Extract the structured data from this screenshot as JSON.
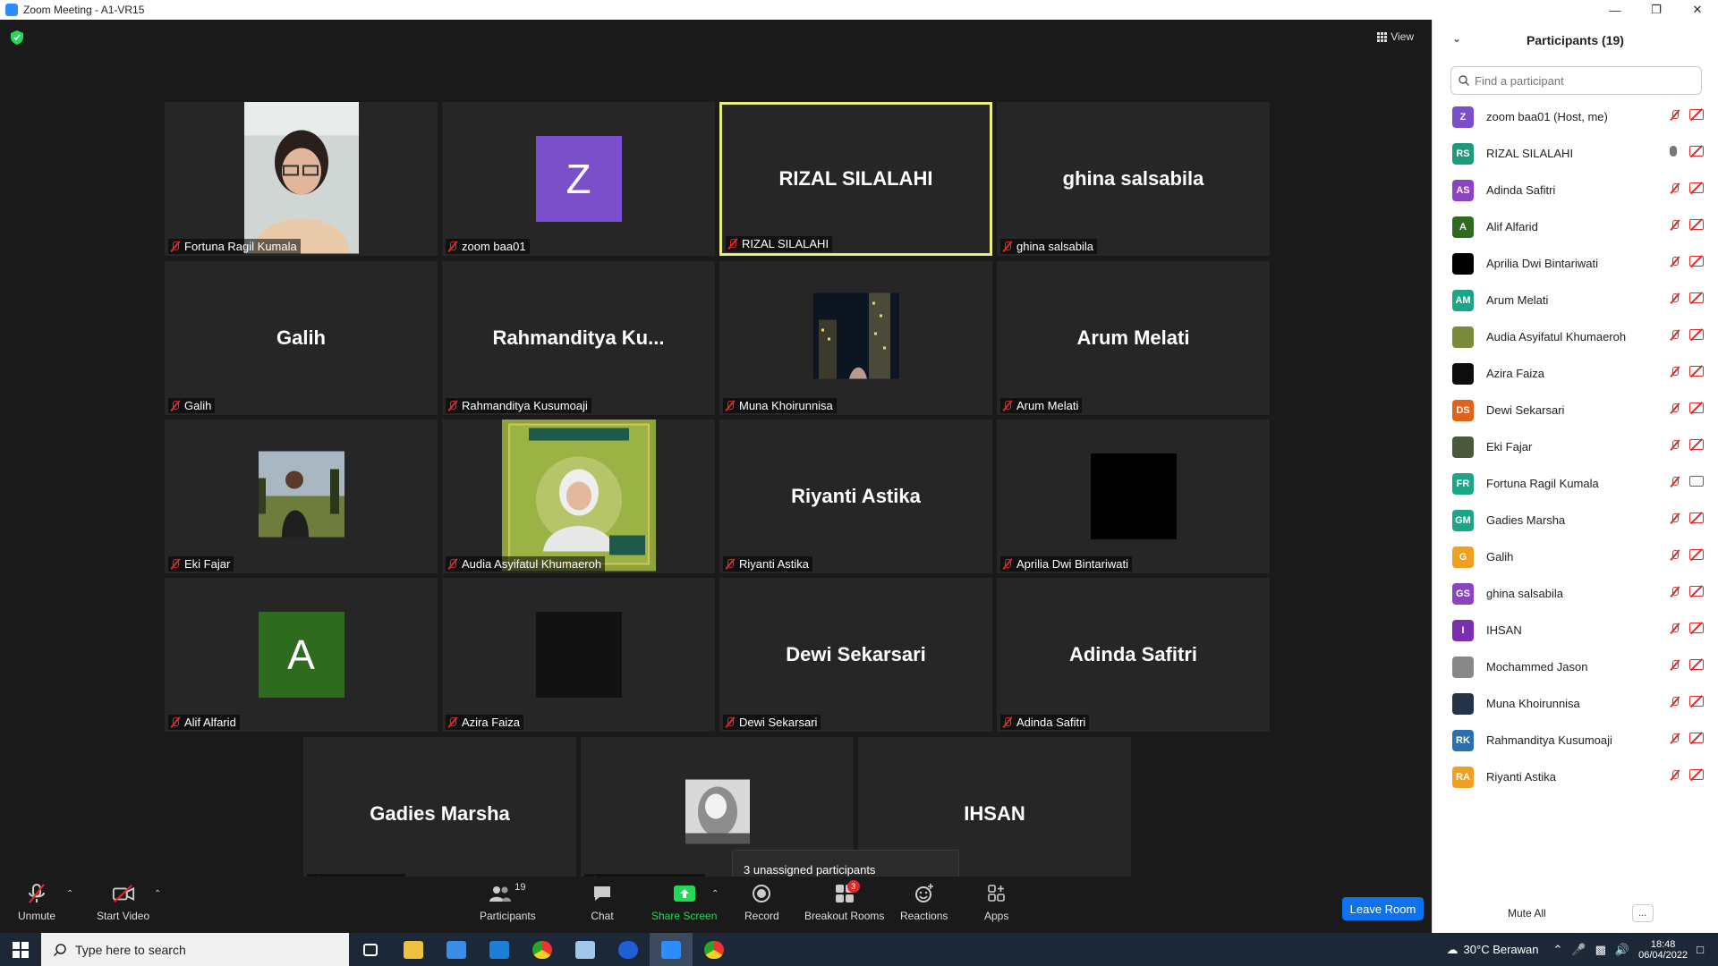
{
  "window": {
    "title": "Zoom Meeting - A1-VR15",
    "min": "—",
    "max": "❐",
    "close": "✕"
  },
  "stage": {
    "view_label": "View"
  },
  "tiles": [
    {
      "id": "t1",
      "caption": "Fortuna Ragil Kumala",
      "big": "",
      "type": "photo",
      "photo": "girl"
    },
    {
      "id": "t2",
      "caption": "zoom baa01",
      "big": "",
      "type": "letter",
      "letter": "Z",
      "color": "#7b4fc9"
    },
    {
      "id": "t3",
      "caption": "RIZAL SILALAHI",
      "big": "RIZAL SILALAHI",
      "type": "name",
      "active": true
    },
    {
      "id": "t4",
      "caption": "ghina salsabila",
      "big": "ghina salsabila",
      "type": "name"
    },
    {
      "id": "t5",
      "caption": "Galih",
      "big": "Galih",
      "type": "name"
    },
    {
      "id": "t6",
      "caption": "Rahmanditya Kusumoaji",
      "big": "Rahmanditya  Ku...",
      "type": "name"
    },
    {
      "id": "t7",
      "caption": "Muna Khoirunnisa",
      "big": "",
      "type": "photo",
      "photo": "city"
    },
    {
      "id": "t8",
      "caption": "Arum Melati",
      "big": "Arum Melati",
      "type": "name"
    },
    {
      "id": "t9",
      "caption": "Eki Fajar",
      "big": "",
      "type": "photo",
      "photo": "field"
    },
    {
      "id": "t10",
      "caption": "Audia Asyifatul Khumaeroh",
      "big": "",
      "type": "photo",
      "photo": "poster"
    },
    {
      "id": "t11",
      "caption": "Riyanti Astika",
      "big": "Riyanti Astika",
      "type": "name"
    },
    {
      "id": "t12",
      "caption": "Aprilia Dwi Bintariwati",
      "big": "",
      "type": "letter",
      "letter": "",
      "color": "#000000"
    },
    {
      "id": "t13",
      "caption": "Alif Alfarid",
      "big": "",
      "type": "letter",
      "letter": "A",
      "color": "#2e6b1f"
    },
    {
      "id": "t14",
      "caption": "Azira Faiza",
      "big": "",
      "type": "letter",
      "letter": "",
      "color": "#121212"
    },
    {
      "id": "t15",
      "caption": "Dewi Sekarsari",
      "big": "Dewi Sekarsari",
      "type": "name"
    },
    {
      "id": "t16",
      "caption": "Adinda Safitri",
      "big": "Adinda Safitri",
      "type": "name"
    },
    {
      "id": "t17",
      "caption": "Gadies Marsha",
      "big": "Gadies Marsha",
      "type": "name"
    },
    {
      "id": "t18",
      "caption": "Mochammed Jason",
      "big": "",
      "type": "photo",
      "photo": "statue"
    },
    {
      "id": "t19",
      "caption": "",
      "big": "IHSAN",
      "type": "name"
    }
  ],
  "popup": {
    "text": "3 unassigned participants"
  },
  "toolbar": {
    "unmute": "Unmute",
    "start_video": "Start Video",
    "participants": "Participants",
    "participants_count": "19",
    "chat": "Chat",
    "share_screen": "Share Screen",
    "record": "Record",
    "breakout_rooms": "Breakout Rooms",
    "breakout_badge": "3",
    "reactions": "Reactions",
    "apps": "Apps",
    "leave": "Leave Room"
  },
  "panel": {
    "title": "Participants (19)",
    "search_placeholder": "Find a participant",
    "mute_all": "Mute All",
    "more": "...",
    "participants": [
      {
        "initials": "Z",
        "name": "zoom baa01 (Host, me)",
        "color": "#7b4fc9",
        "mic": "off",
        "video": "off"
      },
      {
        "initials": "RS",
        "name": "RIZAL SILALAHI",
        "color": "#1c9a7a",
        "mic": "on",
        "video": "off"
      },
      {
        "initials": "AS",
        "name": "Adinda Safitri",
        "color": "#8a43c2",
        "mic": "off",
        "video": "off"
      },
      {
        "initials": "A",
        "name": "Alif Alfarid",
        "color": "#2e6b1f",
        "mic": "off",
        "video": "off"
      },
      {
        "initials": "",
        "name": "Aprilia Dwi Bintariwati",
        "color": "#000000",
        "mic": "off",
        "video": "off"
      },
      {
        "initials": "AM",
        "name": "Arum Melati",
        "color": "#1ca688",
        "mic": "off",
        "video": "off"
      },
      {
        "initials": "",
        "name": "Audia Asyifatul Khumaeroh",
        "color": "#7a8b3a",
        "mic": "off",
        "video": "off"
      },
      {
        "initials": "",
        "name": "Azira Faiza",
        "color": "#0d0d0d",
        "mic": "off",
        "video": "off"
      },
      {
        "initials": "DS",
        "name": "Dewi Sekarsari",
        "color": "#e0631b",
        "mic": "off",
        "video": "off"
      },
      {
        "initials": "",
        "name": "Eki Fajar",
        "color": "#4a5a3a",
        "mic": "off",
        "video": "off"
      },
      {
        "initials": "FR",
        "name": "Fortuna Ragil Kumala",
        "color": "#1ca688",
        "mic": "off",
        "video": "on"
      },
      {
        "initials": "GM",
        "name": "Gadies Marsha",
        "color": "#1ca688",
        "mic": "off",
        "video": "off"
      },
      {
        "initials": "G",
        "name": "Galih",
        "color": "#f0a020",
        "mic": "off",
        "video": "off"
      },
      {
        "initials": "GS",
        "name": "ghina salsabila",
        "color": "#8a43c2",
        "mic": "off",
        "video": "off"
      },
      {
        "initials": "I",
        "name": "IHSAN",
        "color": "#7b2fb0",
        "mic": "off",
        "video": "off"
      },
      {
        "initials": "",
        "name": "Mochammed Jason",
        "color": "#888888",
        "mic": "off",
        "video": "off"
      },
      {
        "initials": "",
        "name": "Muna Khoirunnisa",
        "color": "#24344a",
        "mic": "off",
        "video": "off"
      },
      {
        "initials": "RK",
        "name": "Rahmanditya Kusumoaji",
        "color": "#2a6fb0",
        "mic": "off",
        "video": "off"
      },
      {
        "initials": "RA",
        "name": "Riyanti Astika",
        "color": "#f0a020",
        "mic": "off",
        "video": "off"
      }
    ]
  },
  "taskbar": {
    "search_placeholder": "Type here to search",
    "weather": "30°C  Berawan",
    "time": "18:48",
    "date": "06/04/2022"
  }
}
